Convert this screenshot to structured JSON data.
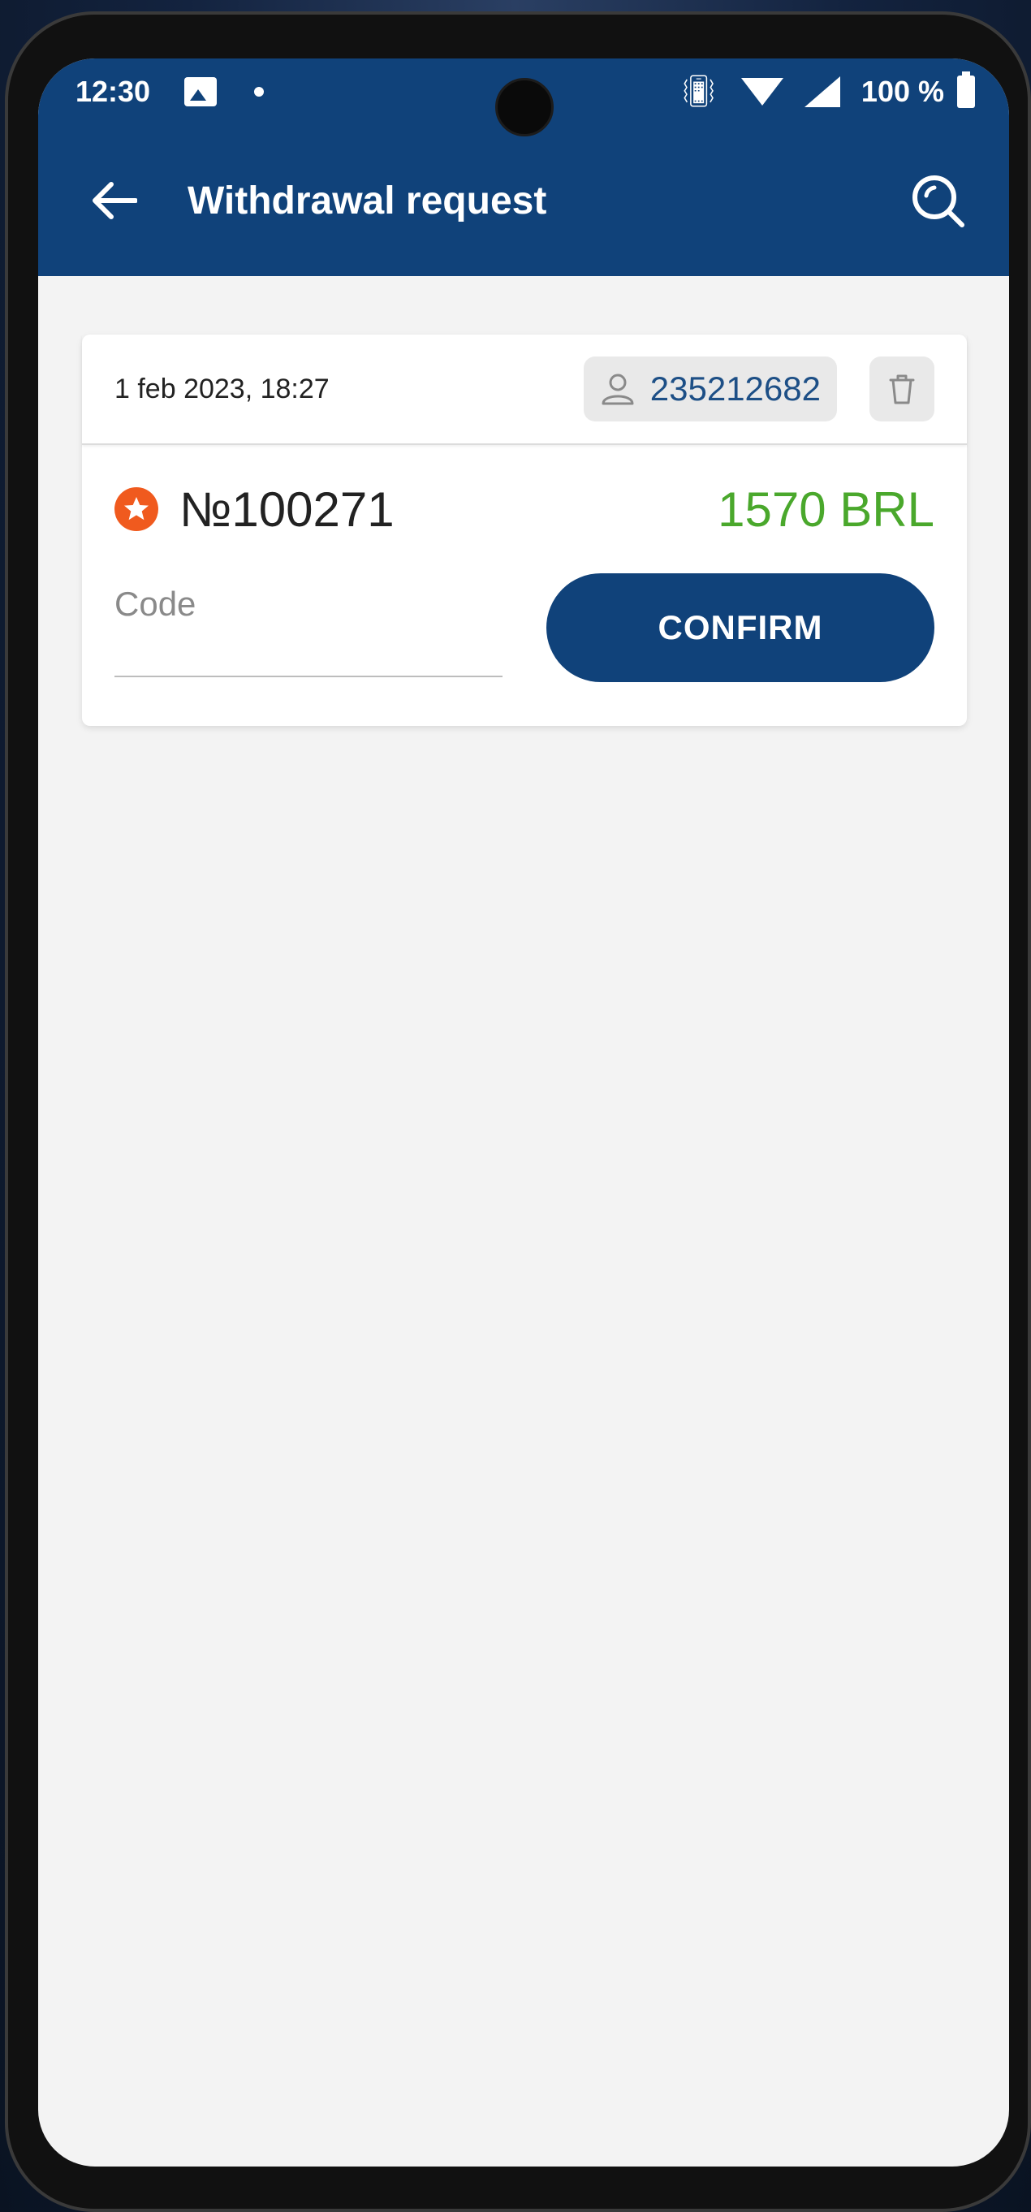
{
  "status_bar": {
    "time": "12:30",
    "battery": "100 %",
    "icons": [
      "gallery-icon",
      "dot-icon",
      "vibrate-icon",
      "wifi-icon",
      "signal-icon",
      "battery-icon"
    ]
  },
  "app_bar": {
    "title": "Withdrawal request",
    "back_icon": "arrow-left-icon",
    "search_icon": "search-icon",
    "background": "#10427a"
  },
  "request": {
    "date": "1 feb 2023, 18:27",
    "user_id": "235212682",
    "order_number": "№100271",
    "amount": "1570 BRL",
    "amount_color": "#4aa82c",
    "badge_color": "#f05a1e",
    "code_placeholder": "Code",
    "code_value": "",
    "confirm_label": "CONFIRM"
  }
}
